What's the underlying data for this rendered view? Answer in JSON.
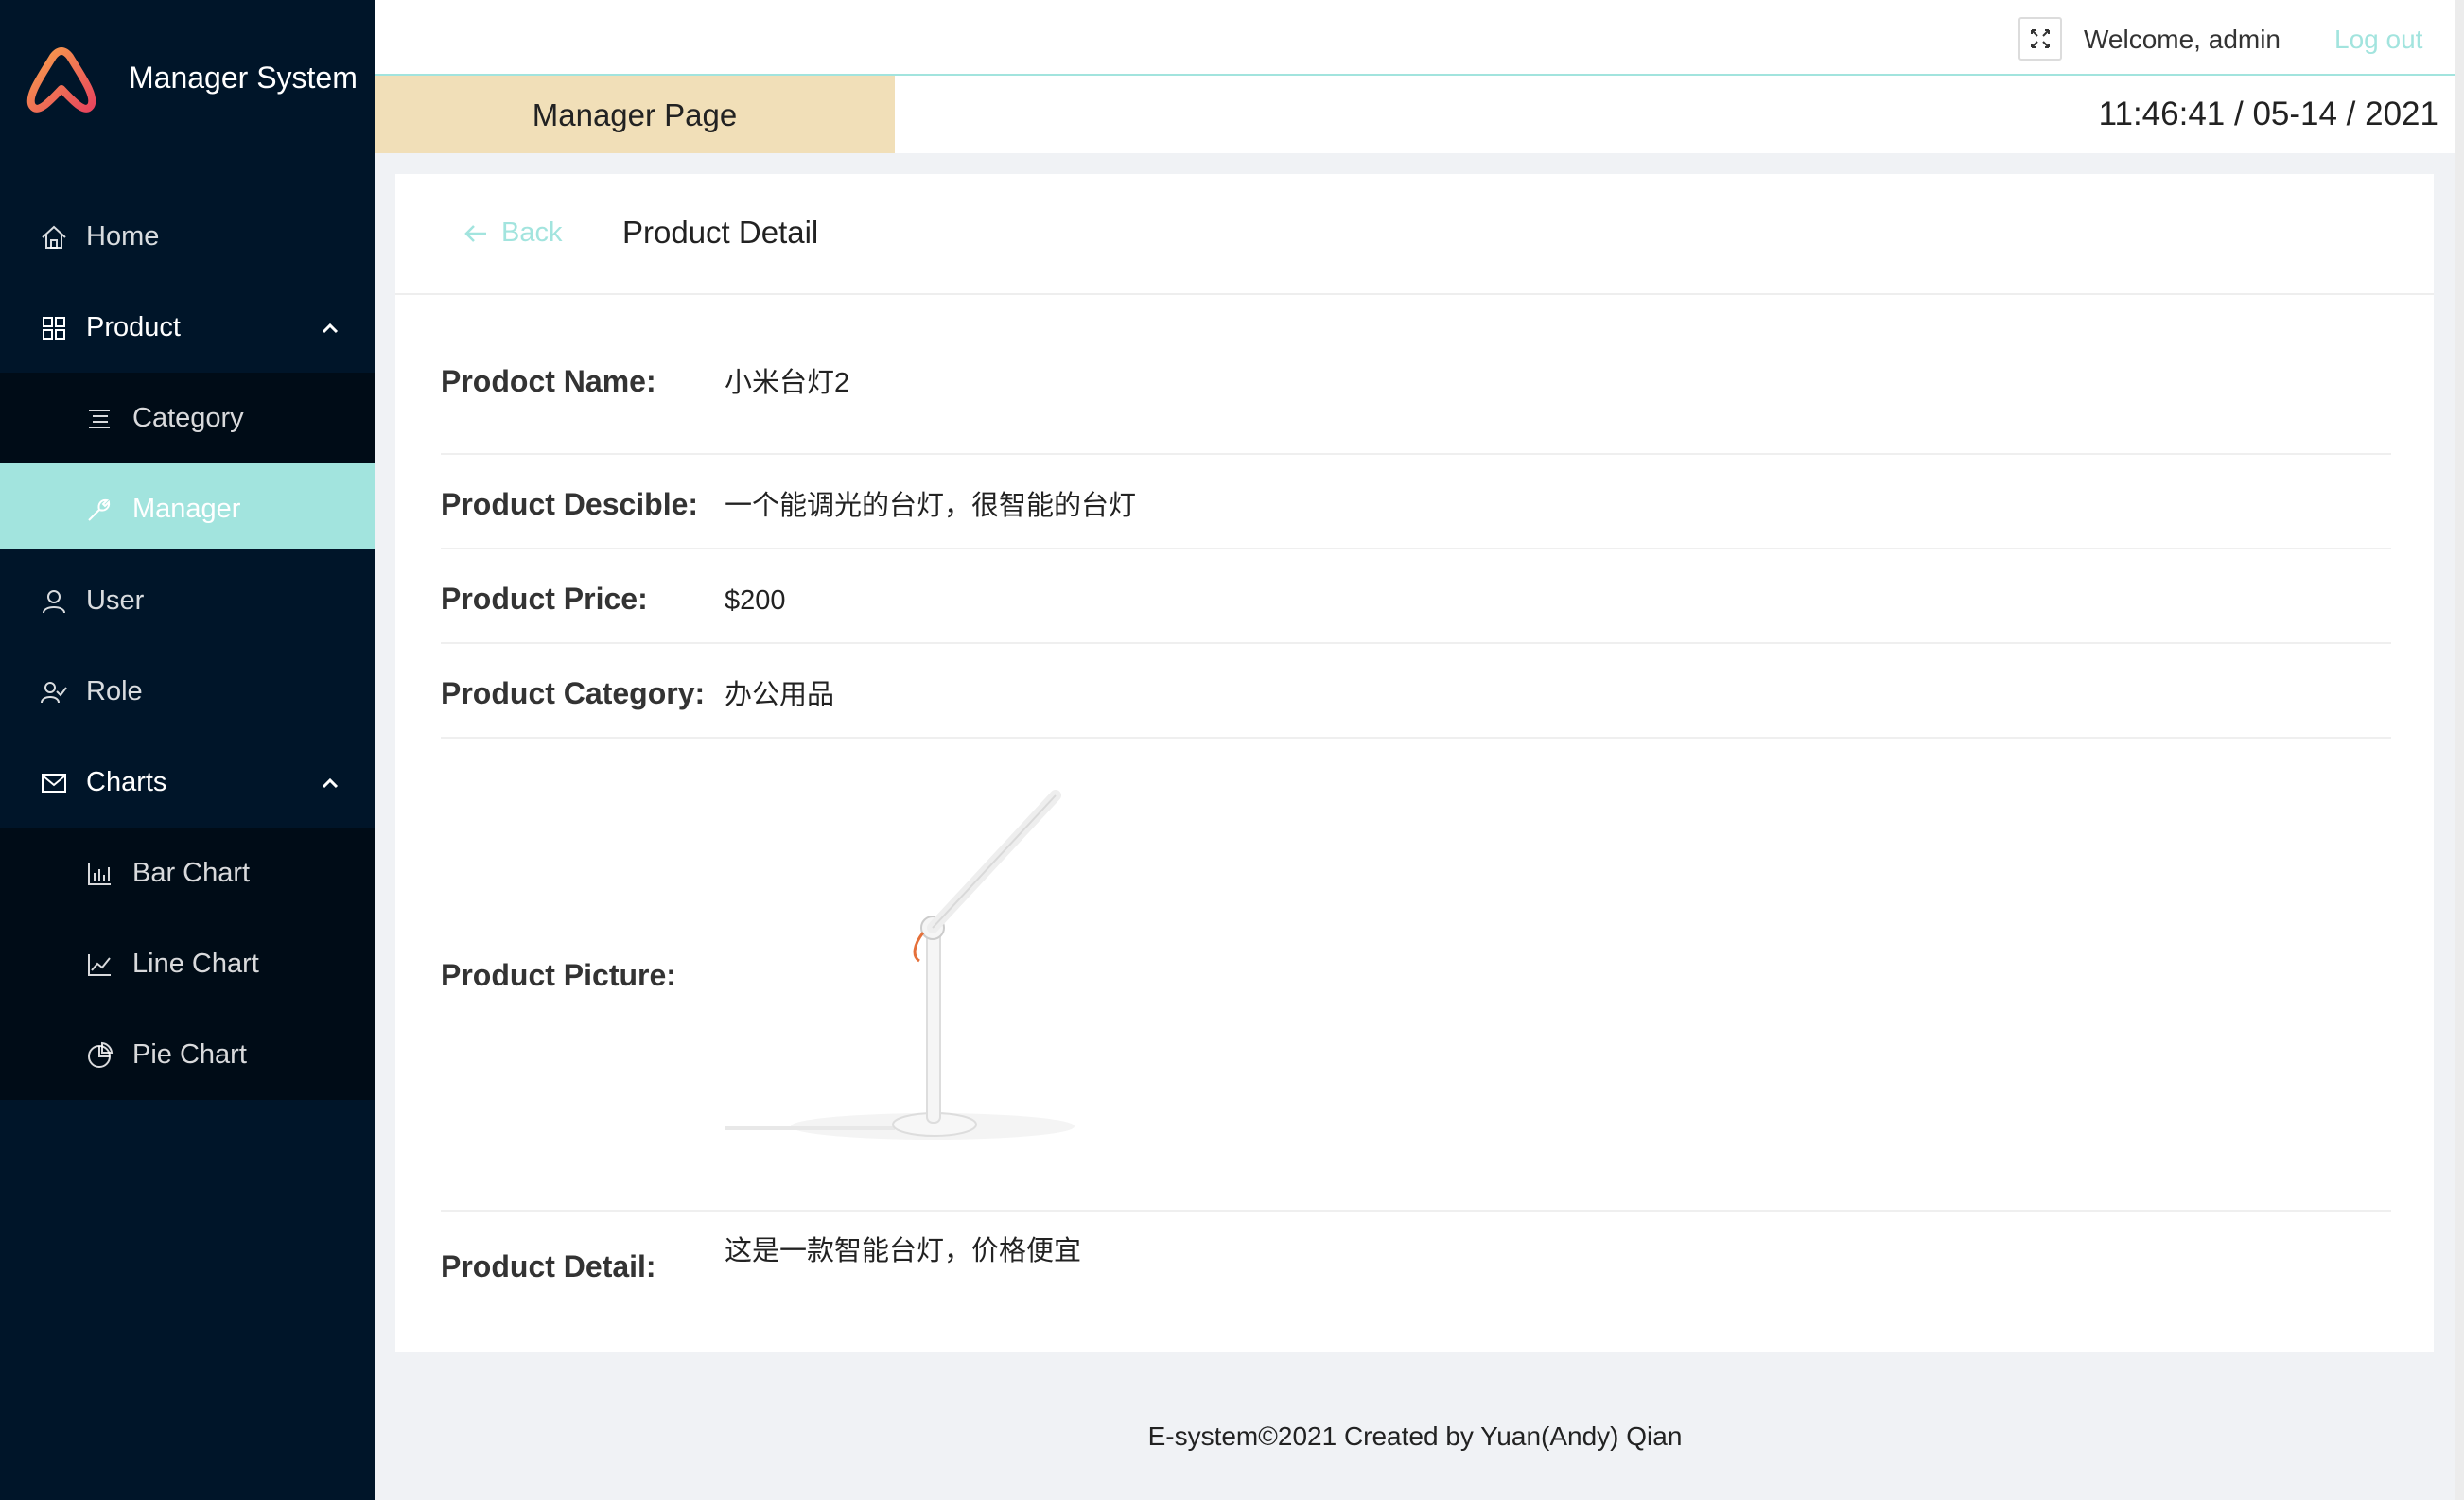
{
  "brand": {
    "name": "Manager System"
  },
  "sidebar": {
    "items": [
      {
        "label": "Home",
        "icon": "home-icon"
      },
      {
        "label": "Product",
        "icon": "appstore-icon",
        "expanded": true,
        "children": [
          {
            "label": "Category",
            "icon": "bars-icon"
          },
          {
            "label": "Manager",
            "icon": "tool-icon",
            "selected": true
          }
        ]
      },
      {
        "label": "User",
        "icon": "user-icon"
      },
      {
        "label": "Role",
        "icon": "team-icon"
      },
      {
        "label": "Charts",
        "icon": "mail-icon",
        "expanded": true,
        "children": [
          {
            "label": "Bar Chart",
            "icon": "bar-chart-icon"
          },
          {
            "label": "Line Chart",
            "icon": "line-chart-icon"
          },
          {
            "label": "Pie Chart",
            "icon": "pie-chart-icon"
          }
        ]
      }
    ]
  },
  "header": {
    "welcome": "Welcome, admin",
    "logout": "Log out",
    "page_title": "Manager Page",
    "datetime": "11:46:41 / 05-14 / 2021"
  },
  "detail": {
    "back_label": "Back",
    "title": "Product Detail",
    "fields": [
      {
        "key": "Prodoct Name:",
        "value": "小米台灯2"
      },
      {
        "key": "Product Descible:",
        "value": "一个能调光的台灯，很智能的台灯"
      },
      {
        "key": "Product Price:",
        "value": "$200"
      },
      {
        "key": "Product Category:",
        "value": "办公用品"
      },
      {
        "key": "Product Picture:",
        "value": ""
      },
      {
        "key": "Product Detail:",
        "value": "这是一款智能台灯，价格便宜"
      }
    ]
  },
  "footer": {
    "text": "E-system©2021 Created by Yuan(Andy) Qian"
  },
  "colors": {
    "sidebar": "#001529",
    "accent": "#a2e4de",
    "tab": "#f1dfb8",
    "background": "#f0f2f5"
  }
}
